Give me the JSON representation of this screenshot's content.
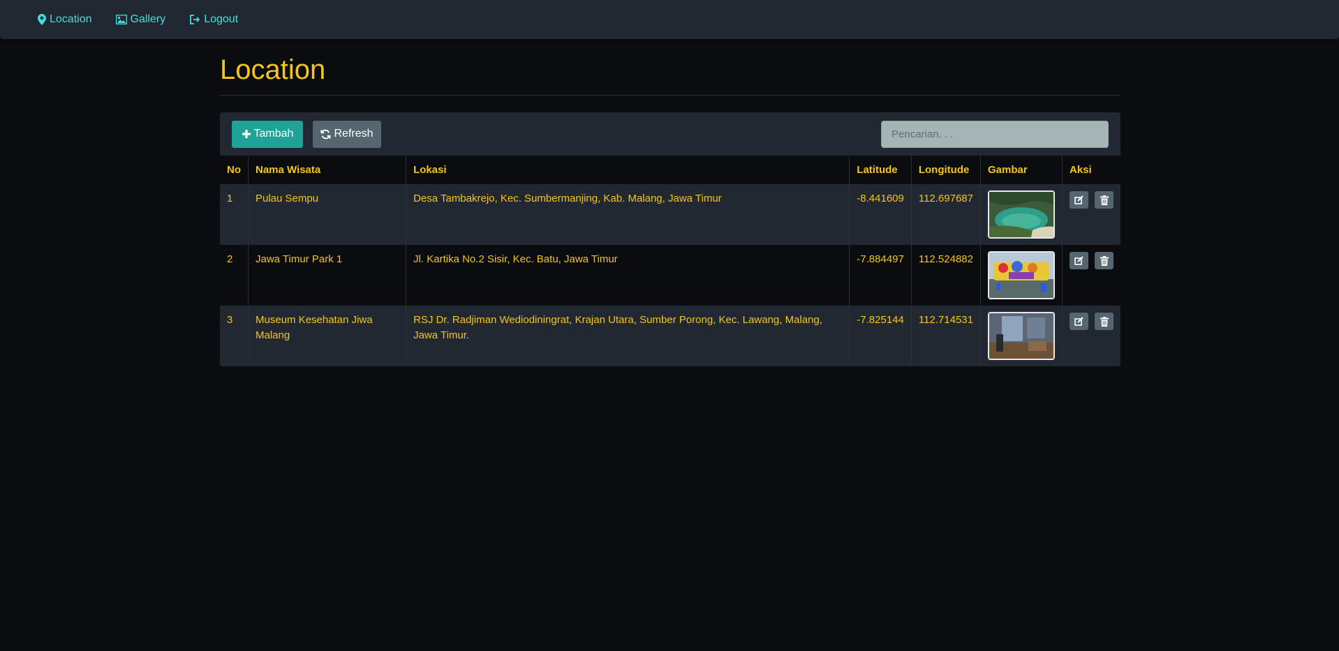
{
  "nav": {
    "items": [
      {
        "label": "Location",
        "icon": "map-marker-icon"
      },
      {
        "label": "Gallery",
        "icon": "image-icon"
      },
      {
        "label": "Logout",
        "icon": "logout-icon"
      }
    ]
  },
  "page": {
    "title": "Location"
  },
  "toolbar": {
    "add_label": "Tambah",
    "refresh_label": "Refresh",
    "search_placeholder": "Pencarian. . ."
  },
  "table": {
    "headers": [
      "No",
      "Nama Wisata",
      "Lokasi",
      "Latitude",
      "Longitude",
      "Gambar",
      "Aksi"
    ],
    "rows": [
      {
        "no": "1",
        "name": "Pulau Sempu",
        "location": "Desa Tambakrejo, Kec. Sumbermanjing, Kab. Malang, Jawa Timur",
        "lat": "-8.441609",
        "lng": "112.697687",
        "image": "beach-lagoon"
      },
      {
        "no": "2",
        "name": "Jawa Timur Park 1",
        "location": "Jl. Kartika No.2 Sisir, Kec. Batu, Jawa Timur",
        "lat": "-7.884497",
        "lng": "112.524882",
        "image": "theme-park"
      },
      {
        "no": "3",
        "name": "Museum Kesehatan Jiwa Malang",
        "location": "RSJ Dr. Radjiman Wediodiningrat, Krajan Utara, Sumber Porong, Kec. Lawang, Malang, Jawa Timur.",
        "lat": "-7.825144",
        "lng": "112.714531",
        "image": "museum-room"
      }
    ]
  },
  "colors": {
    "accent": "#f5c518",
    "link": "#3fe0e0",
    "primary": "#1fa398",
    "secondary": "#566670",
    "background": "#0a0c10",
    "panel": "#222831"
  }
}
